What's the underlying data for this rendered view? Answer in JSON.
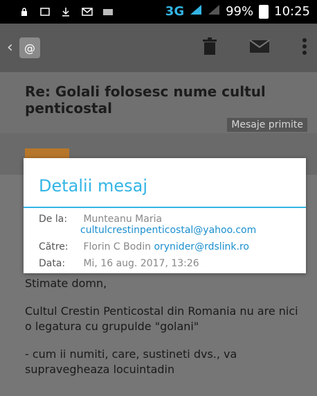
{
  "status_bar": {
    "network": "3G",
    "battery": "99%",
    "time": "10:25"
  },
  "action_bar": {
    "back_icon": "chevron-left-icon",
    "app_icon": "email-icon",
    "actions": [
      "delete-icon",
      "mark-unread-icon",
      "overflow-menu-icon"
    ]
  },
  "message": {
    "subject": "Re: Golali folosesc nume cultul penticostal",
    "folder": "Mesaje primite"
  },
  "details_dialog": {
    "title": "Detalii mesaj",
    "from_label": "De la:",
    "from_name": "Munteanu Maria",
    "from_email": "cultulcrestinpenticostal@yahoo.com",
    "to_label": "Către:",
    "to_name": "Florin C Bodin",
    "to_email": "orynider@rdslink.ro",
    "date_label": "Data:",
    "date_value": "Mi, 16 aug. 2017, 13:26"
  },
  "body": {
    "greeting": "Stimate domn,",
    "paragraph1": "Cultul Crestin Penticostal din Romania nu are nici o legatura cu grupulde \"golani\"",
    "paragraph2": " - cum ii numiti, care, sustineti dvs., va supravegheaza locuintadin"
  },
  "colors": {
    "accent": "#33b5e5",
    "dim_overlay": "#6f6f6f"
  }
}
